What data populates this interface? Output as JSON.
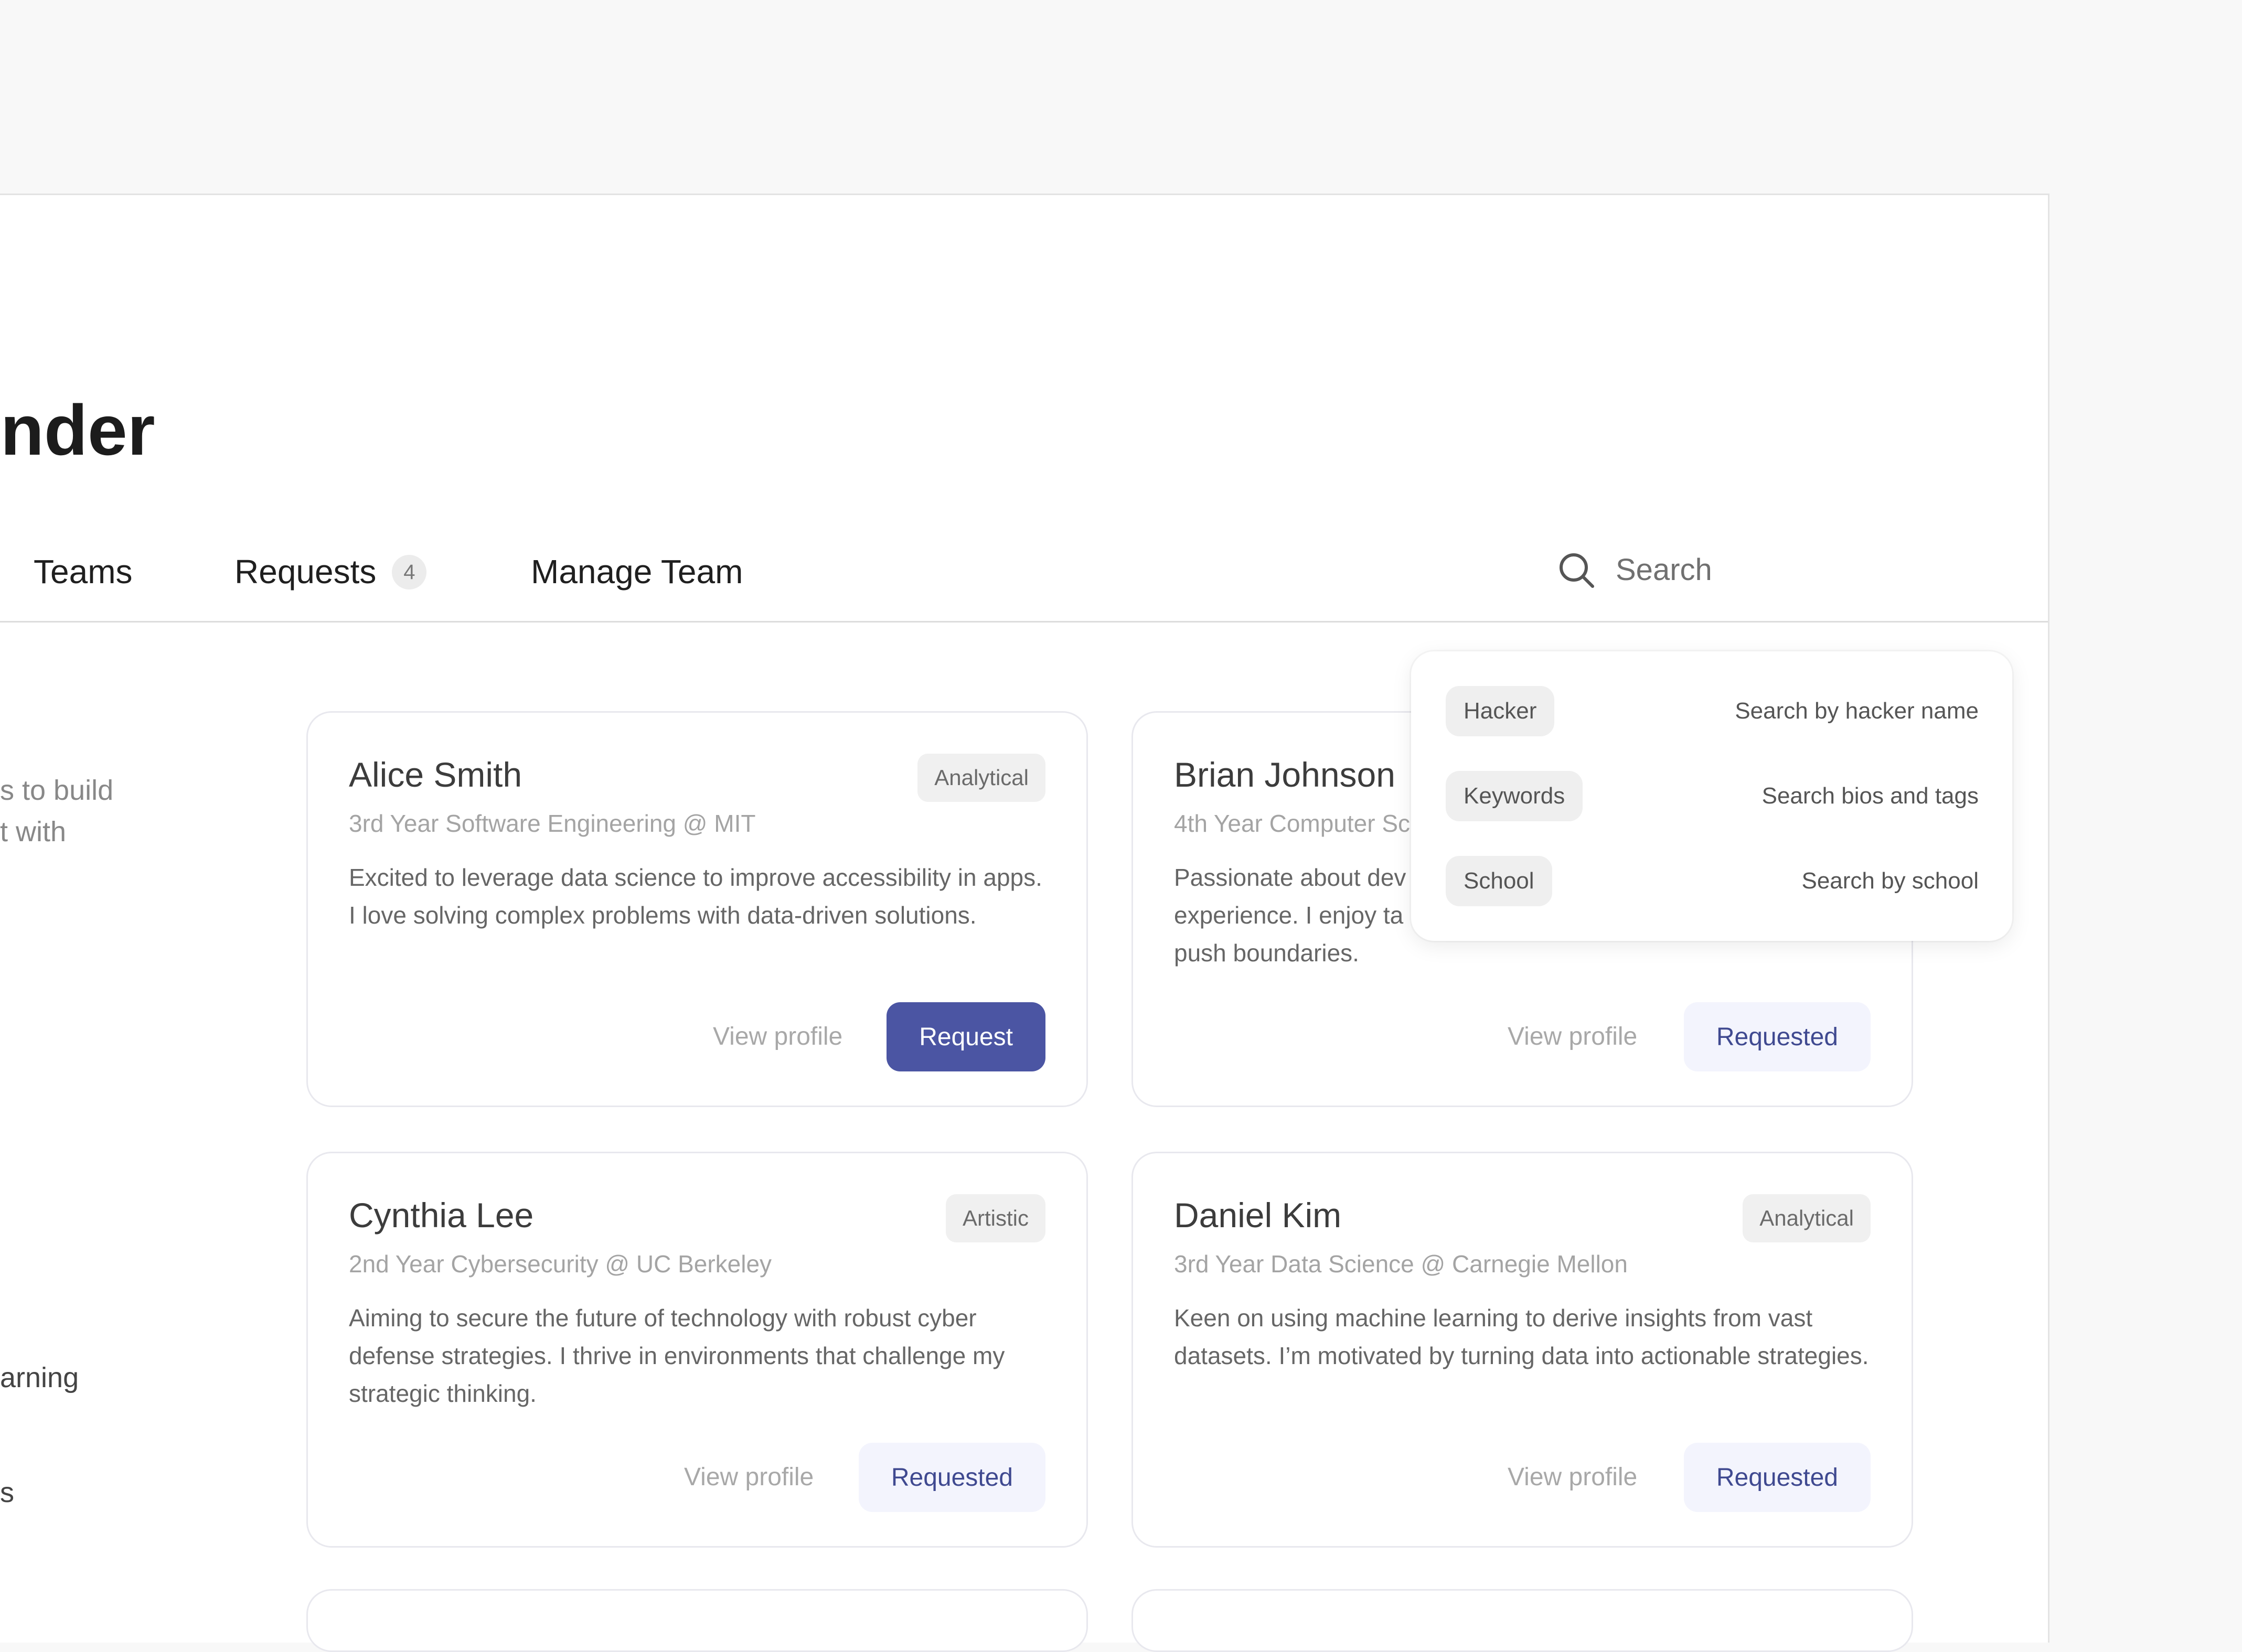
{
  "page": {
    "title": "Finder"
  },
  "tabs": [
    {
      "label": "Teams"
    },
    {
      "label": "Requests",
      "badge": "4"
    },
    {
      "label": "Manage Team"
    }
  ],
  "search": {
    "placeholder": "Search",
    "icon": "search-icon"
  },
  "search_options": [
    {
      "chip": "Hacker",
      "description": "Search by hacker name"
    },
    {
      "chip": "Keywords",
      "description": "Search bios and tags"
    },
    {
      "chip": "School",
      "description": "Search by school"
    }
  ],
  "sidebar": {
    "line1": "s to build",
    "line2": "t with",
    "line3": "arning",
    "line4": "s"
  },
  "cards": [
    {
      "name": "Alice Smith",
      "tag": "Analytical",
      "subtitle": "3rd Year Software Engineering @ MIT",
      "bio": "Excited to leverage data science to improve accessibility in apps. I love solving complex problems with data-driven solutions.",
      "view_label": "View profile",
      "action_label": "Request"
    },
    {
      "name": "Brian Johnson",
      "tag": "",
      "subtitle": "4th Year Computer Sc",
      "bio": "Passionate about dev experience. I enjoy ta push boundaries.",
      "view_label": "View profile",
      "action_label": "Requested"
    },
    {
      "name": "Cynthia Lee",
      "tag": "Artistic",
      "subtitle": "2nd Year Cybersecurity @ UC Berkeley",
      "bio": "Aiming to secure the future of technology with robust cyber defense strategies. I thrive in environments that challenge my strategic thinking.",
      "view_label": "View profile",
      "action_label": "Requested"
    },
    {
      "name": "Daniel Kim",
      "tag": "Analytical",
      "subtitle": "3rd Year Data Science @ Carnegie Mellon",
      "bio": "Keen on using machine learning to derive insights from vast datasets. I’m motivated by turning data into actionable strategies.",
      "view_label": "View profile",
      "action_label": "Requested"
    }
  ],
  "colors": {
    "primary": "#4b55a3",
    "requested_bg": "#f3f4fd",
    "requested_text": "#3f4990"
  }
}
